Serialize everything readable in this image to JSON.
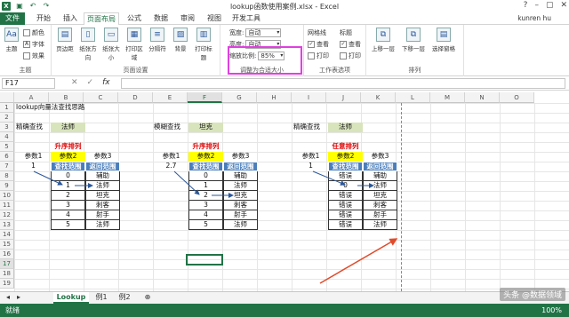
{
  "window": {
    "title": "lookup函数使用案例.xlsx - Excel",
    "user": "kunren hu"
  },
  "tabs": [
    "文件",
    "开始",
    "插入",
    "页面布局",
    "公式",
    "数据",
    "审阅",
    "视图",
    "开发工具"
  ],
  "ribbon": {
    "theme_group": {
      "label": "主题",
      "items": [
        "颜色",
        "字体",
        "效果"
      ],
      "big": "主题"
    },
    "page_setup": {
      "label": "页面设置",
      "buttons": [
        "页边距",
        "纸张方向",
        "纸张大小",
        "打印区域",
        "分隔符",
        "背景",
        "打印标题"
      ]
    },
    "scale": {
      "label": "调整为合适大小",
      "width_label": "宽度:",
      "width_val": "自动",
      "height_label": "高度:",
      "height_val": "自动",
      "scale_label": "缩放比例:",
      "scale_val": "85%"
    },
    "sheet_options": {
      "label": "工作表选项",
      "gridlines": "网格线",
      "headings": "标题",
      "view": "查看",
      "print": "打印"
    },
    "arrange": {
      "label": "排列",
      "buttons": [
        "上移一层",
        "下移一层",
        "选择窗格"
      ]
    }
  },
  "formula_bar": {
    "name_box": "F17",
    "fx": "fx"
  },
  "columns": [
    "A",
    "B",
    "C",
    "D",
    "E",
    "F",
    "G",
    "H",
    "I",
    "J",
    "K",
    "L",
    "M",
    "N",
    "O"
  ],
  "rows": [
    "1",
    "2",
    "3",
    "4",
    "5",
    "6",
    "7",
    "8",
    "9",
    "10",
    "11",
    "12",
    "13",
    "14",
    "15",
    "16",
    "17",
    "18",
    "19"
  ],
  "cells": {
    "title": "lookup向量法查找思路",
    "exact1": "精确查找",
    "exact1_val": "法师",
    "fuzzy": "模糊查找",
    "fuzzy_val": "坦克",
    "exact2": "精确查找",
    "exact2_val": "法师",
    "sort_asc1": "升序排列",
    "sort_asc2": "升序排列",
    "sort_any": "任意排列",
    "p1": "参数1",
    "p2": "参数2",
    "p3": "参数3",
    "find_range": "查找范围",
    "return_range": "返回范围",
    "v1": "1",
    "v2": "2.7",
    "v3": "1",
    "list1_nums": [
      "0",
      "1",
      "2",
      "3",
      "4",
      "5"
    ],
    "list_roles": [
      "辅助",
      "法师",
      "坦克",
      "刺客",
      "射手",
      "法师"
    ],
    "list3_errs": [
      "错误",
      "0",
      "错误",
      "错误",
      "错误",
      "错误"
    ]
  },
  "sheets": [
    "Lookup",
    "例1",
    "例2"
  ],
  "status": {
    "ready": "就绪",
    "zoom": "100%"
  },
  "watermark": "头条 @数据领域"
}
